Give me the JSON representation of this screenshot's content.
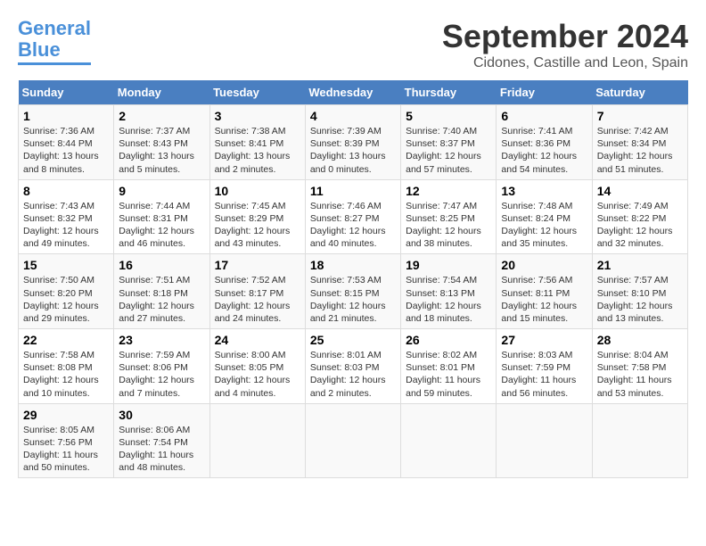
{
  "header": {
    "logo_line1": "General",
    "logo_line2": "Blue",
    "month": "September 2024",
    "location": "Cidones, Castille and Leon, Spain"
  },
  "weekdays": [
    "Sunday",
    "Monday",
    "Tuesday",
    "Wednesday",
    "Thursday",
    "Friday",
    "Saturday"
  ],
  "weeks": [
    [
      {
        "day": "1",
        "text": "Sunrise: 7:36 AM\nSunset: 8:44 PM\nDaylight: 13 hours\nand 8 minutes."
      },
      {
        "day": "2",
        "text": "Sunrise: 7:37 AM\nSunset: 8:43 PM\nDaylight: 13 hours\nand 5 minutes."
      },
      {
        "day": "3",
        "text": "Sunrise: 7:38 AM\nSunset: 8:41 PM\nDaylight: 13 hours\nand 2 minutes."
      },
      {
        "day": "4",
        "text": "Sunrise: 7:39 AM\nSunset: 8:39 PM\nDaylight: 13 hours\nand 0 minutes."
      },
      {
        "day": "5",
        "text": "Sunrise: 7:40 AM\nSunset: 8:37 PM\nDaylight: 12 hours\nand 57 minutes."
      },
      {
        "day": "6",
        "text": "Sunrise: 7:41 AM\nSunset: 8:36 PM\nDaylight: 12 hours\nand 54 minutes."
      },
      {
        "day": "7",
        "text": "Sunrise: 7:42 AM\nSunset: 8:34 PM\nDaylight: 12 hours\nand 51 minutes."
      }
    ],
    [
      {
        "day": "8",
        "text": "Sunrise: 7:43 AM\nSunset: 8:32 PM\nDaylight: 12 hours\nand 49 minutes."
      },
      {
        "day": "9",
        "text": "Sunrise: 7:44 AM\nSunset: 8:31 PM\nDaylight: 12 hours\nand 46 minutes."
      },
      {
        "day": "10",
        "text": "Sunrise: 7:45 AM\nSunset: 8:29 PM\nDaylight: 12 hours\nand 43 minutes."
      },
      {
        "day": "11",
        "text": "Sunrise: 7:46 AM\nSunset: 8:27 PM\nDaylight: 12 hours\nand 40 minutes."
      },
      {
        "day": "12",
        "text": "Sunrise: 7:47 AM\nSunset: 8:25 PM\nDaylight: 12 hours\nand 38 minutes."
      },
      {
        "day": "13",
        "text": "Sunrise: 7:48 AM\nSunset: 8:24 PM\nDaylight: 12 hours\nand 35 minutes."
      },
      {
        "day": "14",
        "text": "Sunrise: 7:49 AM\nSunset: 8:22 PM\nDaylight: 12 hours\nand 32 minutes."
      }
    ],
    [
      {
        "day": "15",
        "text": "Sunrise: 7:50 AM\nSunset: 8:20 PM\nDaylight: 12 hours\nand 29 minutes."
      },
      {
        "day": "16",
        "text": "Sunrise: 7:51 AM\nSunset: 8:18 PM\nDaylight: 12 hours\nand 27 minutes."
      },
      {
        "day": "17",
        "text": "Sunrise: 7:52 AM\nSunset: 8:17 PM\nDaylight: 12 hours\nand 24 minutes."
      },
      {
        "day": "18",
        "text": "Sunrise: 7:53 AM\nSunset: 8:15 PM\nDaylight: 12 hours\nand 21 minutes."
      },
      {
        "day": "19",
        "text": "Sunrise: 7:54 AM\nSunset: 8:13 PM\nDaylight: 12 hours\nand 18 minutes."
      },
      {
        "day": "20",
        "text": "Sunrise: 7:56 AM\nSunset: 8:11 PM\nDaylight: 12 hours\nand 15 minutes."
      },
      {
        "day": "21",
        "text": "Sunrise: 7:57 AM\nSunset: 8:10 PM\nDaylight: 12 hours\nand 13 minutes."
      }
    ],
    [
      {
        "day": "22",
        "text": "Sunrise: 7:58 AM\nSunset: 8:08 PM\nDaylight: 12 hours\nand 10 minutes."
      },
      {
        "day": "23",
        "text": "Sunrise: 7:59 AM\nSunset: 8:06 PM\nDaylight: 12 hours\nand 7 minutes."
      },
      {
        "day": "24",
        "text": "Sunrise: 8:00 AM\nSunset: 8:05 PM\nDaylight: 12 hours\nand 4 minutes."
      },
      {
        "day": "25",
        "text": "Sunrise: 8:01 AM\nSunset: 8:03 PM\nDaylight: 12 hours\nand 2 minutes."
      },
      {
        "day": "26",
        "text": "Sunrise: 8:02 AM\nSunset: 8:01 PM\nDaylight: 11 hours\nand 59 minutes."
      },
      {
        "day": "27",
        "text": "Sunrise: 8:03 AM\nSunset: 7:59 PM\nDaylight: 11 hours\nand 56 minutes."
      },
      {
        "day": "28",
        "text": "Sunrise: 8:04 AM\nSunset: 7:58 PM\nDaylight: 11 hours\nand 53 minutes."
      }
    ],
    [
      {
        "day": "29",
        "text": "Sunrise: 8:05 AM\nSunset: 7:56 PM\nDaylight: 11 hours\nand 50 minutes."
      },
      {
        "day": "30",
        "text": "Sunrise: 8:06 AM\nSunset: 7:54 PM\nDaylight: 11 hours\nand 48 minutes."
      },
      {
        "day": "",
        "text": ""
      },
      {
        "day": "",
        "text": ""
      },
      {
        "day": "",
        "text": ""
      },
      {
        "day": "",
        "text": ""
      },
      {
        "day": "",
        "text": ""
      }
    ]
  ]
}
